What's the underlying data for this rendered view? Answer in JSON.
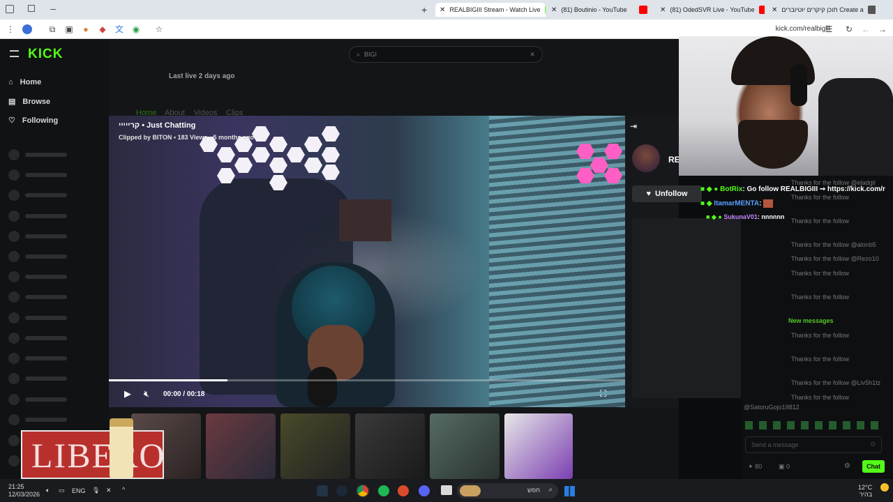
{
  "tabs": [
    {
      "label": "REALBIGIII Stream - Watch Live",
      "active": true,
      "favicon_color": "#53fc18"
    },
    {
      "label": "(81) Boutinio - YouTube",
      "active": false,
      "favicon_color": "#ff0000"
    },
    {
      "label": "(81) OdedSVR Live - YouTube",
      "active": false,
      "favicon_color": "#ff0000"
    },
    {
      "label": "תוכן קיקרים יוטיוברים Create a",
      "active": false,
      "favicon_color": "#555555"
    }
  ],
  "browser": {
    "url": "kick.com/realbigiii"
  },
  "kick": {
    "logo": "KICK",
    "search": {
      "value": "BIGI"
    },
    "last_live": "Last live 2 days ago",
    "nav": [
      {
        "label": "Home"
      },
      {
        "label": "Browse"
      },
      {
        "label": "Following"
      }
    ],
    "channel_tabs": [
      "Home",
      "About",
      "Videos",
      "Clips"
    ]
  },
  "video": {
    "title": "קרייייי • Just Chatting",
    "subtitle": "Clipped by BITON • 183 Views • 5 months ago",
    "time": "00:00 / 00:18",
    "progress": 0.23
  },
  "panel": {
    "unfollow_label": "Unfollow",
    "name_partial": "RE"
  },
  "chat": {
    "highlight": [
      {
        "user": "BotRix",
        "text": ": Go follow REALBIGIII ➞ https://kick.com/r",
        "color": "#53fc18"
      },
      {
        "user": "ItamarMENTA",
        "text": ":",
        "color": "#5aa0ff"
      },
      {
        "user": "SukunaV01",
        "text": ": nnnnnn",
        "color": "#c889ff"
      }
    ],
    "lines": [
      "Thanks for the follow @eladgil",
      "Thanks for the follow",
      "Thanks for the follow",
      "Thanks for the follow @alonb5",
      "Thanks for the follow @Rezo10",
      "Thanks for the follow",
      "Thanks for the follow",
      "Thanks for the follow",
      "Thanks for the follow",
      "Thanks for the follow @Liv5h1tz",
      "Thanks for the follow"
    ],
    "new_messages": "New messages",
    "last_user": "@SatoruGojo19812",
    "input_placeholder": "Send a message",
    "stats": {
      "a": "80",
      "b": "0"
    },
    "chat_button": "Chat"
  },
  "ad": {
    "text": "LIBERO"
  },
  "taskbar": {
    "time": "21:25",
    "date": "12/03/2026",
    "lang": "ENG",
    "search_placeholder": "חפש",
    "weather_temp": "12°C",
    "weather_desc": "בהיר"
  }
}
